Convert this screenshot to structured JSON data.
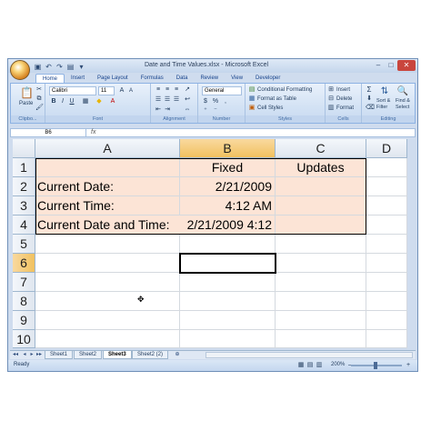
{
  "window": {
    "title": "Date and Time Values.xlsx - Microsoft Excel",
    "qat": [
      "save-icon",
      "undo-icon",
      "redo-icon",
      "print-icon",
      "customize-icon"
    ]
  },
  "ribbon": {
    "tabs": [
      "Home",
      "Insert",
      "Page Layout",
      "Formulas",
      "Data",
      "Review",
      "View",
      "Developer"
    ],
    "active_tab": "Home",
    "clipboard": {
      "paste": "Paste",
      "label": "Clipbo..."
    },
    "font": {
      "name": "Calibri",
      "size": "11",
      "label": "Font",
      "bold": "B",
      "italic": "I",
      "underline": "U"
    },
    "alignment": {
      "label": "Alignment"
    },
    "number": {
      "format": "General",
      "currency": "$",
      "percent": "%",
      "comma": ",",
      "label": "Number"
    },
    "styles": {
      "conditional": "Conditional Formatting",
      "table": "Format as Table",
      "cell": "Cell Styles",
      "label": "Styles"
    },
    "cells": {
      "insert": "Insert",
      "delete": "Delete",
      "format": "Format",
      "label": "Cells"
    },
    "editing": {
      "sum": "Σ",
      "sort": "Sort &",
      "filter": "Filter",
      "find": "Find &",
      "select": "Select",
      "label": "Editing"
    }
  },
  "formula_bar": {
    "name_box": "B6",
    "fx": "fx",
    "formula": ""
  },
  "sheet": {
    "columns": [
      "A",
      "B",
      "C",
      "D"
    ],
    "rows": [
      "1",
      "2",
      "3",
      "4",
      "5",
      "6",
      "7",
      "8",
      "9",
      "10"
    ],
    "cells": {
      "B1": "Fixed",
      "C1": "Updates",
      "A2": "Current Date:",
      "B2": "2/21/2009",
      "A3": "Current Time:",
      "B3": "4:12 AM",
      "A4": "Current Date and Time:",
      "B4": "2/21/2009 4:12"
    },
    "fill_color": "#fce4d6",
    "active_cell": "B6"
  },
  "sheet_tabs": [
    "Sheet1",
    "Sheet2",
    "Sheet3",
    "Sheet2 (2)"
  ],
  "active_sheet": "Sheet3",
  "status": {
    "ready": "Ready",
    "zoom": "200%"
  }
}
